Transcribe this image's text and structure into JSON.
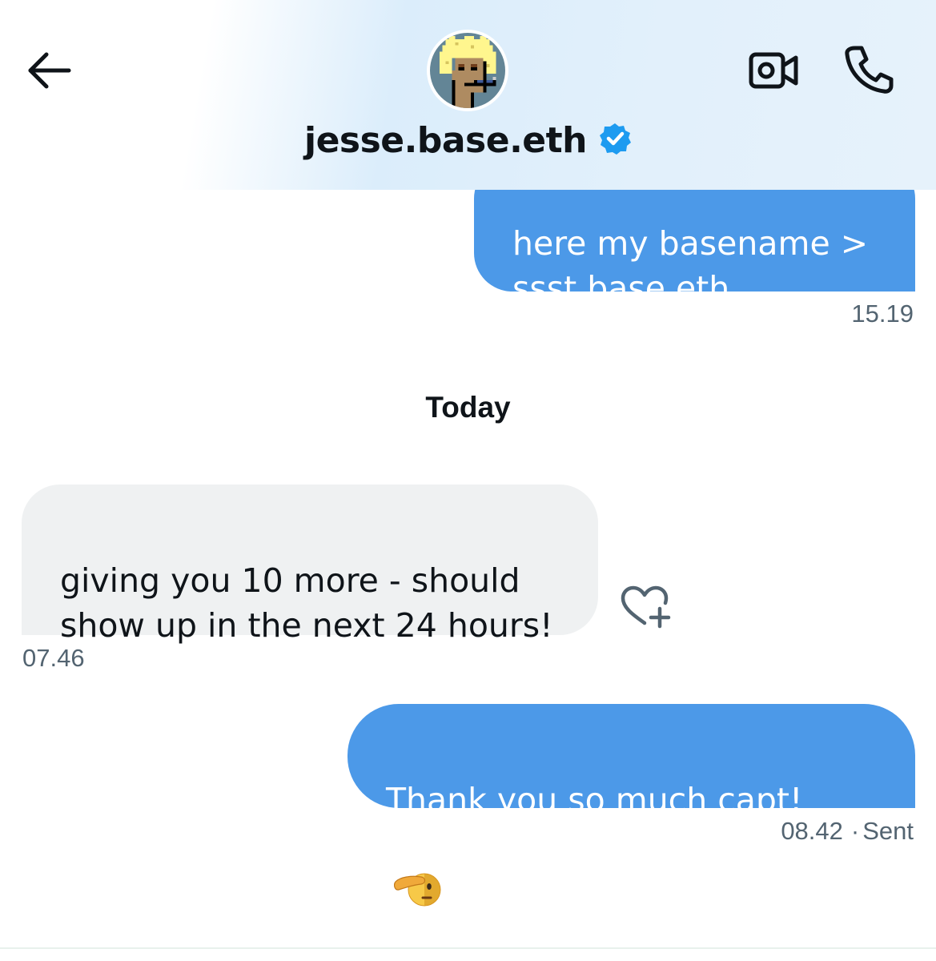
{
  "header": {
    "title": "jesse.base.eth",
    "verified": true,
    "accent_color": "#1d9bf0",
    "icons": {
      "back": "arrow-left-icon",
      "video": "video-camera-icon",
      "call": "phone-icon",
      "avatar": "pixel-punk-avatar",
      "verified": "verified-badge-icon"
    }
  },
  "messages": [
    {
      "direction": "outgoing",
      "text": "here my basename >\nssst.base.eth",
      "time": "15.19"
    },
    {
      "direction": "incoming",
      "text": "giving you 10 more - should\nshow up in the next 24 hours!",
      "time": "07.46",
      "reaction_icon": "heart-plus-icon"
    },
    {
      "direction": "outgoing",
      "text": "Thank you so much capt!",
      "emoji": "saluting-face",
      "time": "08.42",
      "dot": "·",
      "status": "Sent"
    }
  ],
  "day_separator": "Today",
  "colors": {
    "outgoing_bubble": "#4c99e8",
    "incoming_bubble": "#eff1f2",
    "timestamp": "#536471",
    "text": "#0f1419"
  }
}
